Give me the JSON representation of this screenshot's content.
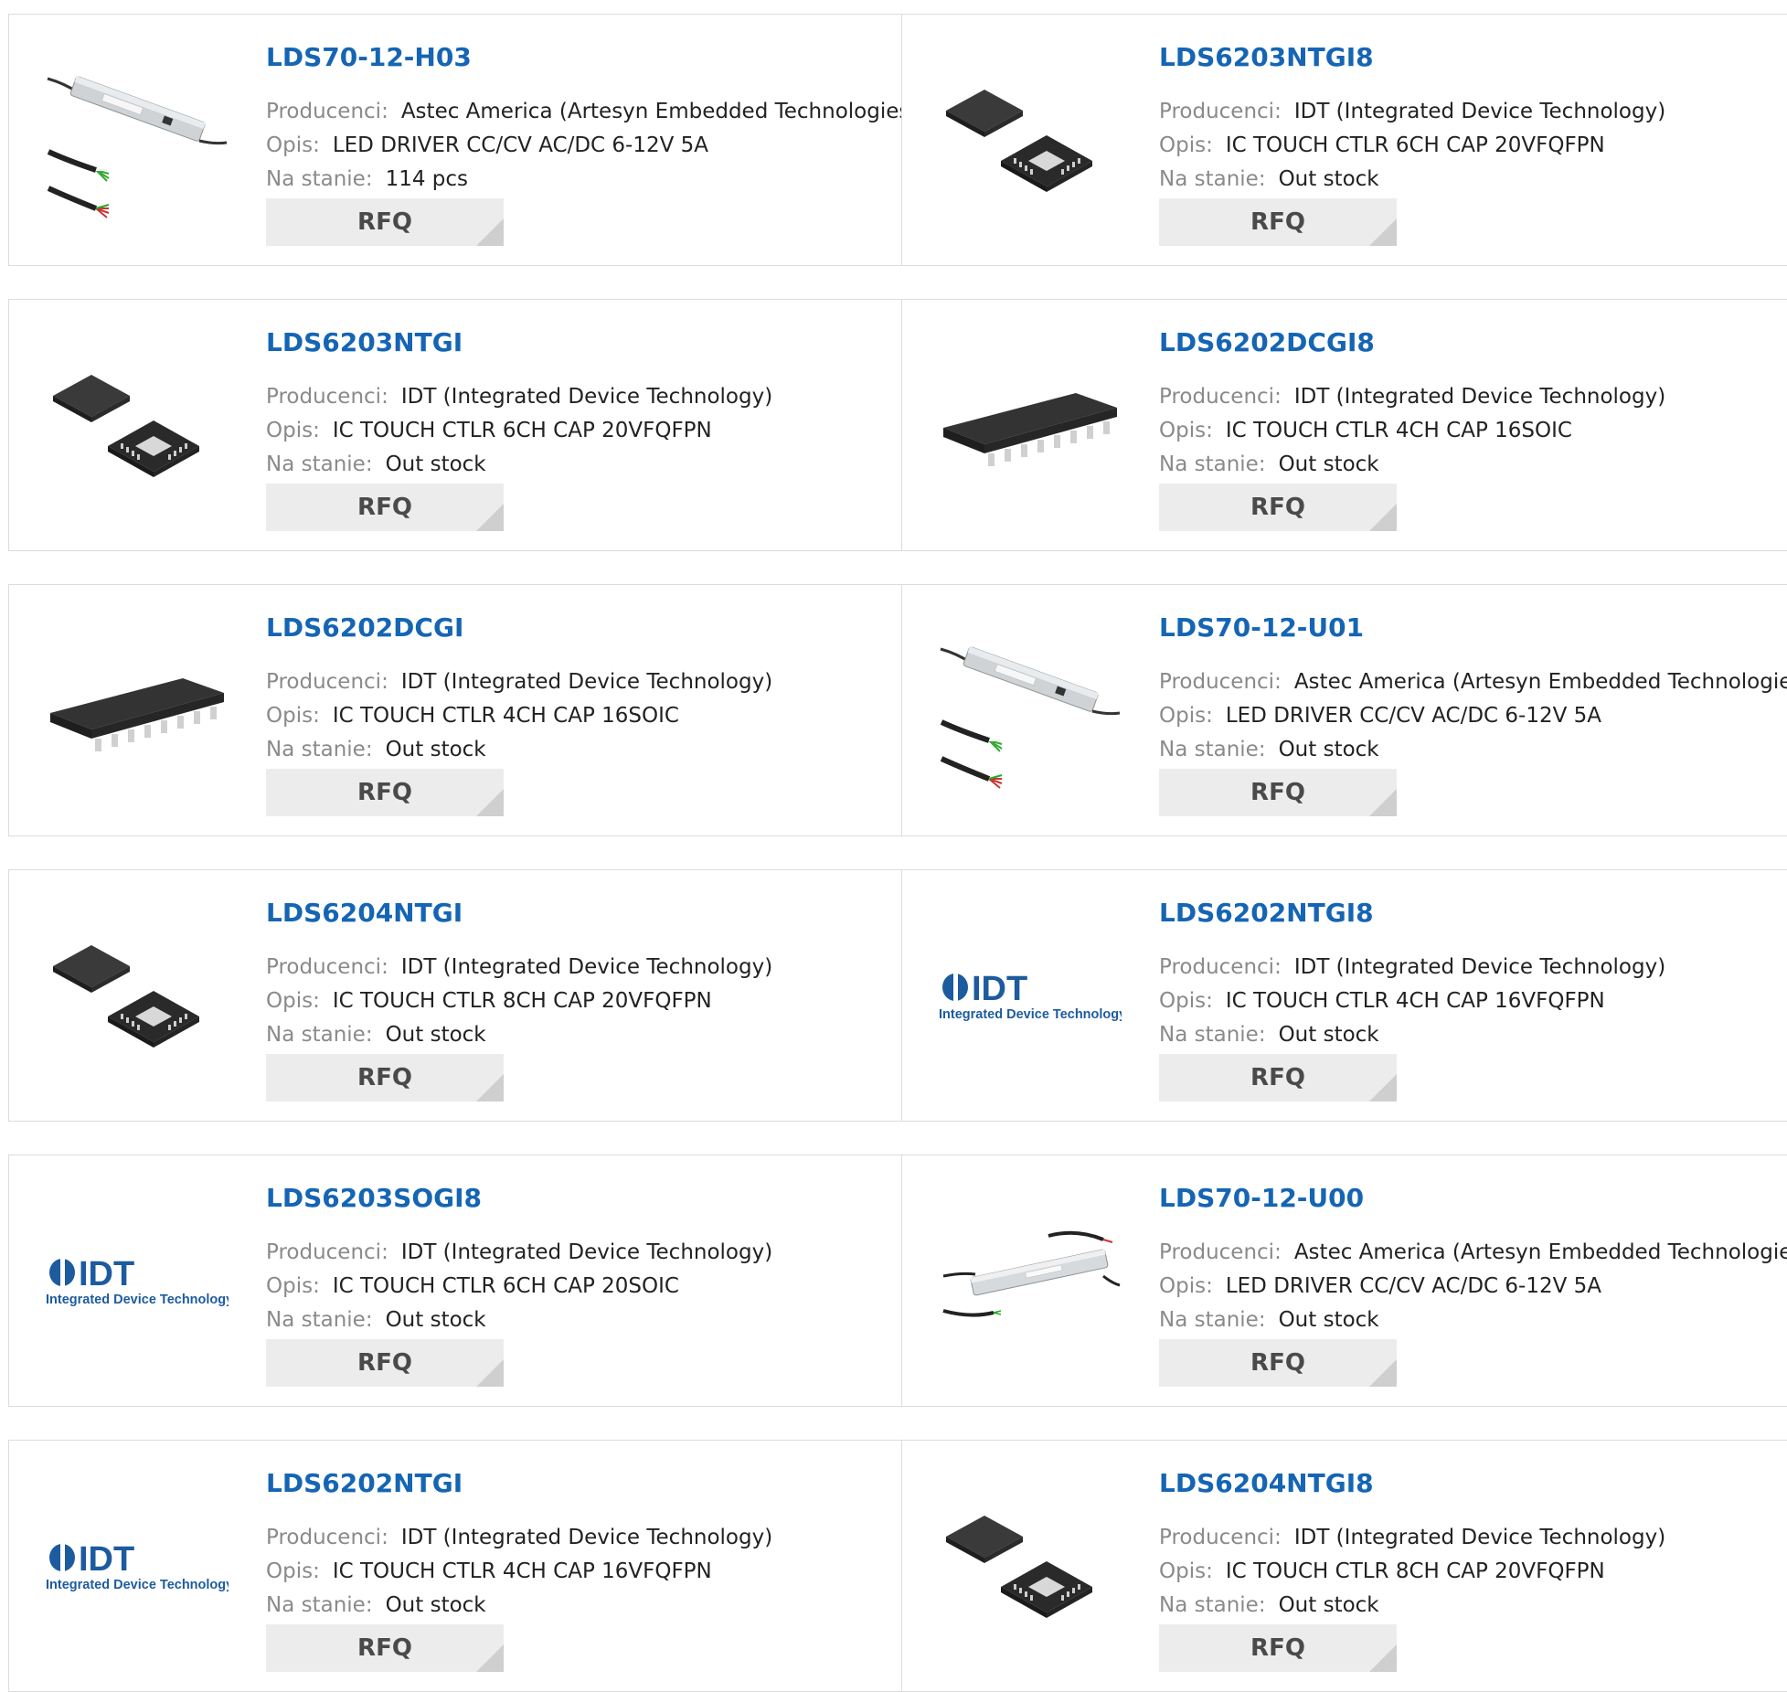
{
  "labels": {
    "manufacturer": "Producenci:",
    "description": "Opis:",
    "stock": "Na stanie:",
    "rfq": "RFQ"
  },
  "logo": {
    "brand": "IDT",
    "tagline": "Integrated Device Technology"
  },
  "products": [
    {
      "part": "LDS70-12-H03",
      "manufacturer": "Astec America (Artesyn Embedded Technologies)",
      "description": "LED DRIVER CC/CV AC/DC 6-12V 5A",
      "stock": "114 pcs",
      "image": "led-driver"
    },
    {
      "part": "LDS6203NTGI8",
      "manufacturer": "IDT (Integrated Device Technology)",
      "description": "IC TOUCH CTLR 6CH CAP 20VFQFPN",
      "stock": "Out stock",
      "image": "qfn-chip"
    },
    {
      "part": "LDS6203NTGI",
      "manufacturer": "IDT (Integrated Device Technology)",
      "description": "IC TOUCH CTLR 6CH CAP 20VFQFPN",
      "stock": "Out stock",
      "image": "qfn-chip"
    },
    {
      "part": "LDS6202DCGI8",
      "manufacturer": "IDT (Integrated Device Technology)",
      "description": "IC TOUCH CTLR 4CH CAP 16SOIC",
      "stock": "Out stock",
      "image": "soic-chip"
    },
    {
      "part": "LDS6202DCGI",
      "manufacturer": "IDT (Integrated Device Technology)",
      "description": "IC TOUCH CTLR 4CH CAP 16SOIC",
      "stock": "Out stock",
      "image": "soic-chip"
    },
    {
      "part": "LDS70-12-U01",
      "manufacturer": "Astec America (Artesyn Embedded Technologies)",
      "description": "LED DRIVER CC/CV AC/DC 6-12V 5A",
      "stock": "Out stock",
      "image": "led-driver"
    },
    {
      "part": "LDS6204NTGI",
      "manufacturer": "IDT (Integrated Device Technology)",
      "description": "IC TOUCH CTLR 8CH CAP 20VFQFPN",
      "stock": "Out stock",
      "image": "qfn-chip"
    },
    {
      "part": "LDS6202NTGI8",
      "manufacturer": "IDT (Integrated Device Technology)",
      "description": "IC TOUCH CTLR 4CH CAP 16VFQFPN",
      "stock": "Out stock",
      "image": "idt-logo"
    },
    {
      "part": "LDS6203SOGI8",
      "manufacturer": "IDT (Integrated Device Technology)",
      "description": "IC TOUCH CTLR 6CH CAP 20SOIC",
      "stock": "Out stock",
      "image": "idt-logo"
    },
    {
      "part": "LDS70-12-U00",
      "manufacturer": "Astec America (Artesyn Embedded Technologies)",
      "description": "LED DRIVER CC/CV AC/DC 6-12V 5A",
      "stock": "Out stock",
      "image": "led-driver-long"
    },
    {
      "part": "LDS6202NTGI",
      "manufacturer": "IDT (Integrated Device Technology)",
      "description": "IC TOUCH CTLR 4CH CAP 16VFQFPN",
      "stock": "Out stock",
      "image": "idt-logo"
    },
    {
      "part": "LDS6204NTGI8",
      "manufacturer": "IDT (Integrated Device Technology)",
      "description": "IC TOUCH CTLR 8CH CAP 20VFQFPN",
      "stock": "Out stock",
      "image": "qfn-chip"
    }
  ]
}
